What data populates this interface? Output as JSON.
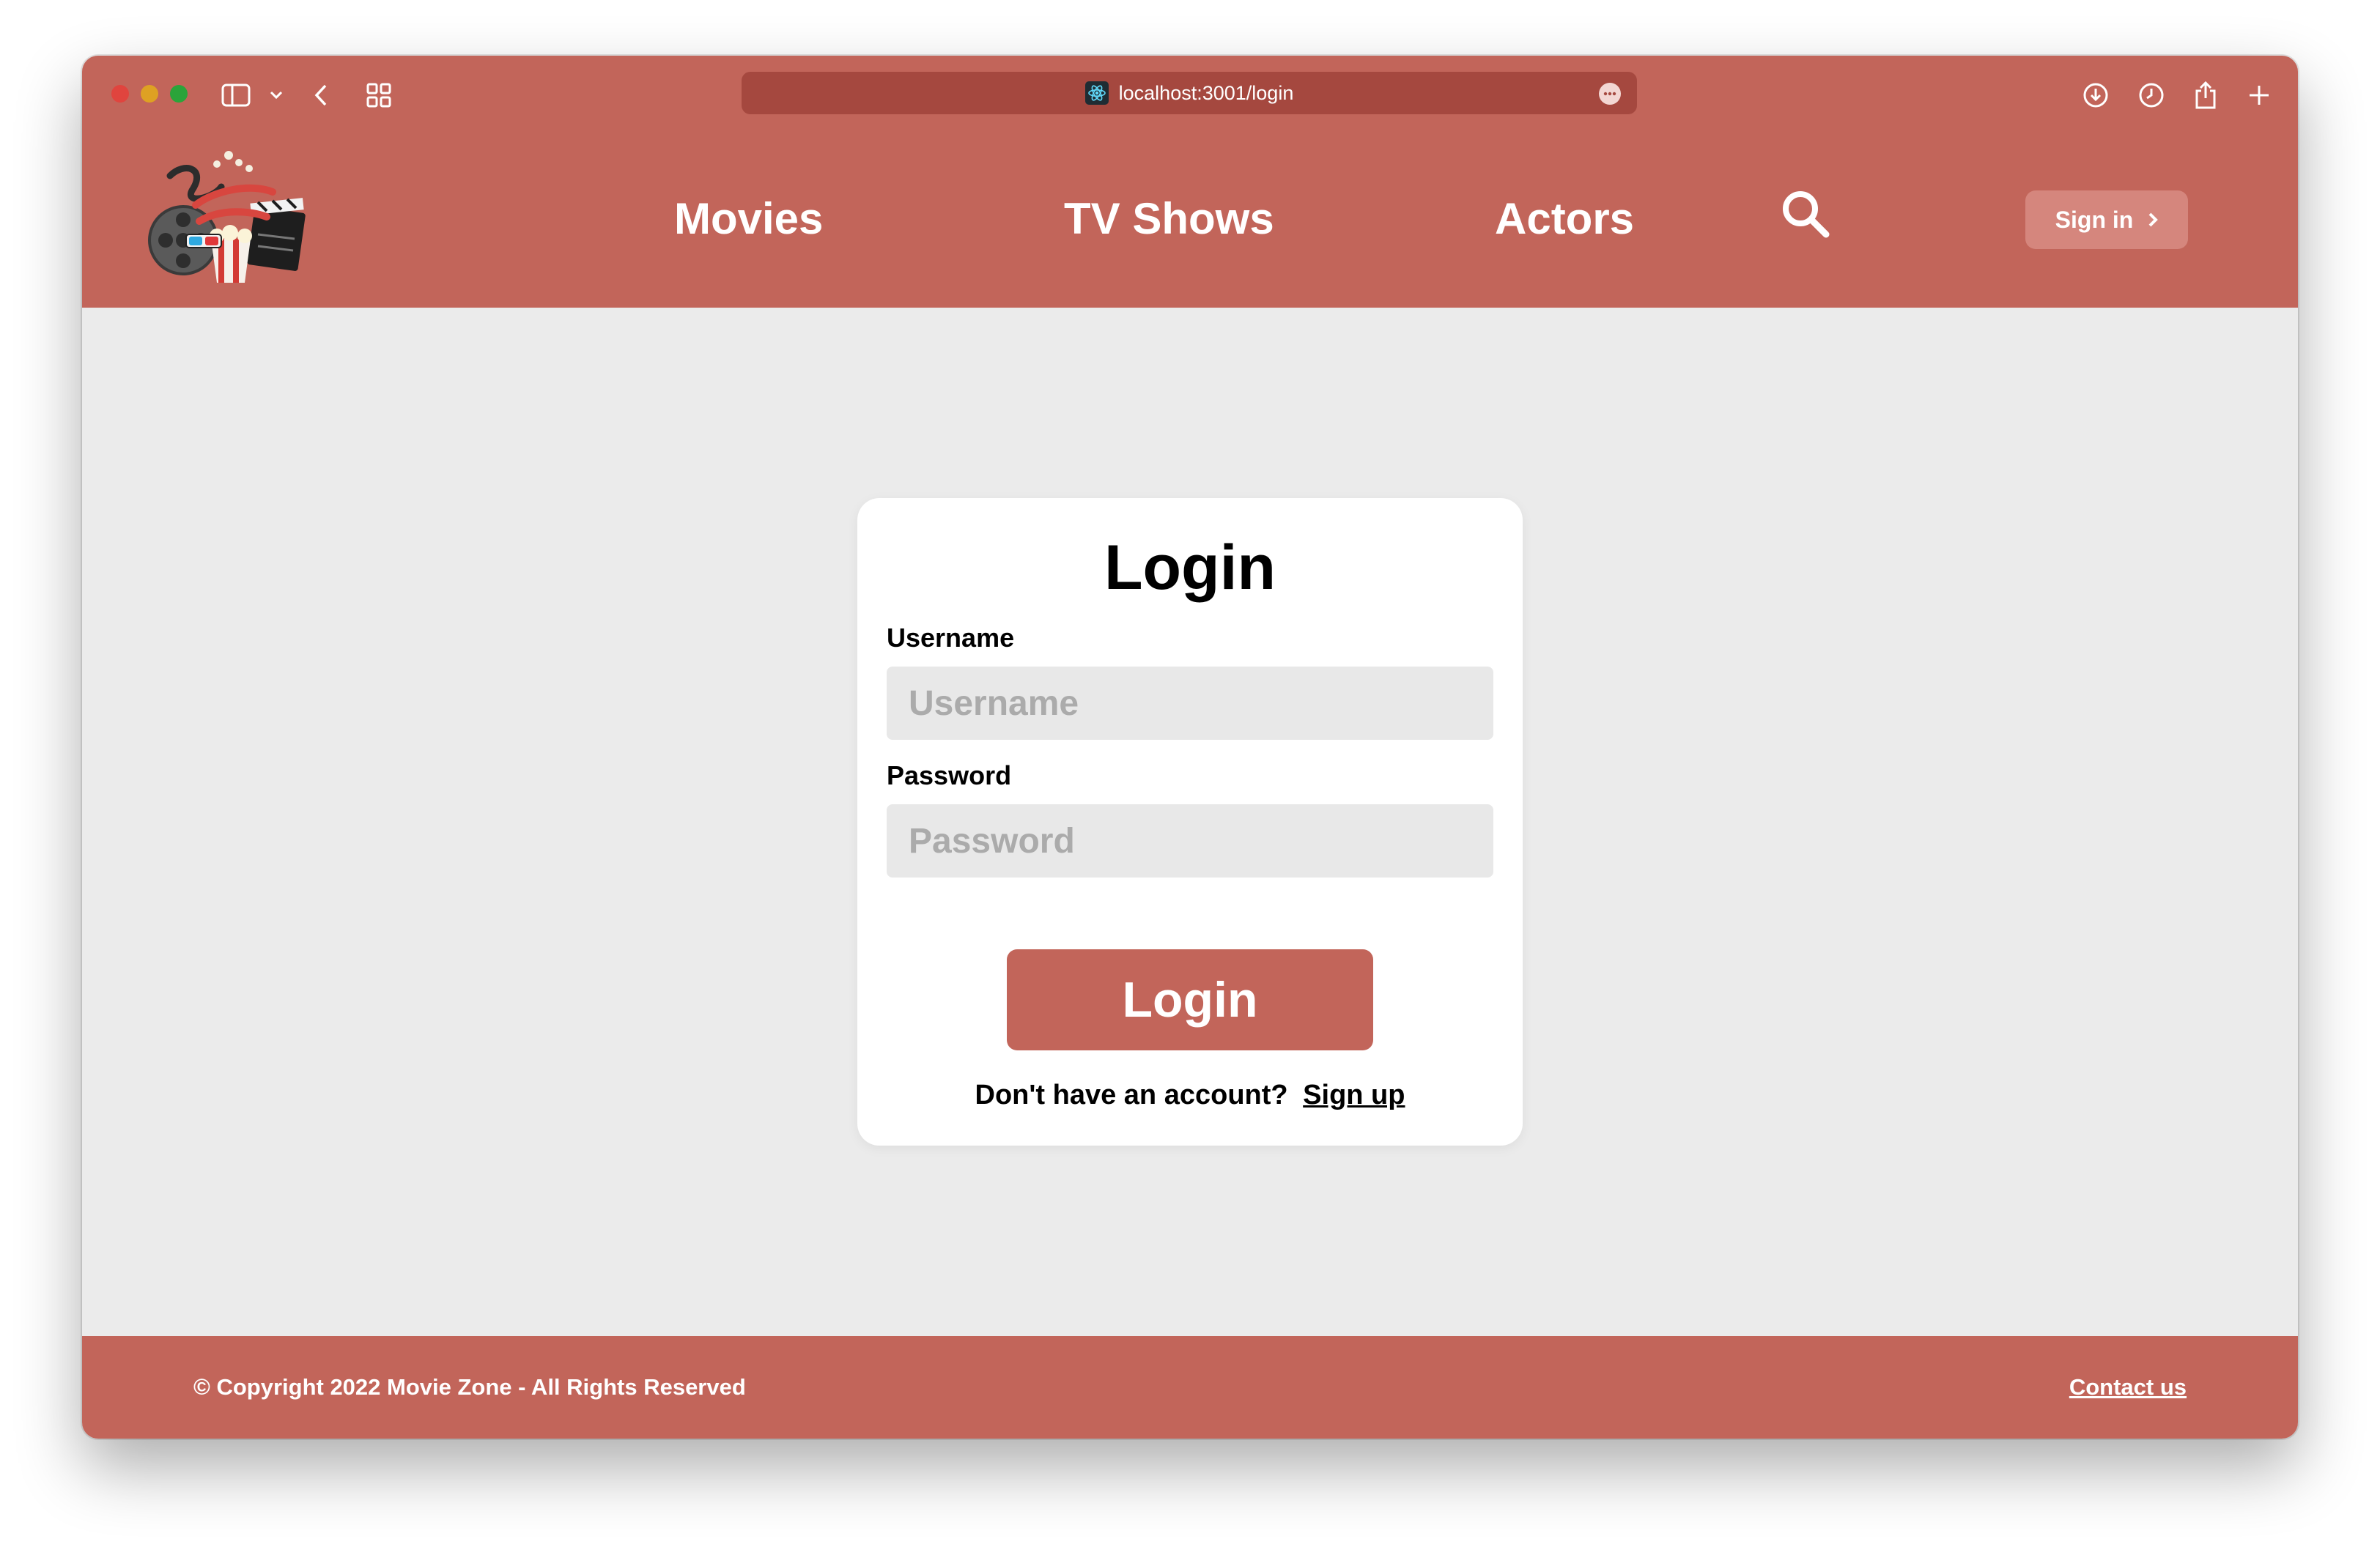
{
  "browser": {
    "url": "localhost:3001/login",
    "favicon": "react-icon",
    "toolbar_icons": [
      "sidebar-icon",
      "chevron-down-icon",
      "back-icon",
      "tab-overview-icon",
      "download-icon",
      "history-icon",
      "share-icon",
      "new-tab-icon"
    ]
  },
  "nav": {
    "logo_alt": "Movie Zone",
    "links": [
      "Movies",
      "TV Shows",
      "Actors"
    ],
    "search_icon": "search-icon",
    "signin_label": "Sign in"
  },
  "login": {
    "title": "Login",
    "username_label": "Username",
    "username_placeholder": "Username",
    "password_label": "Password",
    "password_placeholder": "Password",
    "submit_label": "Login",
    "signup_prompt": "Don't have an account?",
    "signup_link": "Sign up"
  },
  "footer": {
    "copyright": "© Copyright 2022 Movie Zone - All Rights Reserved",
    "contact": "Contact us"
  },
  "colors": {
    "brand": "#c2655a",
    "background": "#ebebeb",
    "card": "#ffffff",
    "input": "#e8e8e8"
  }
}
